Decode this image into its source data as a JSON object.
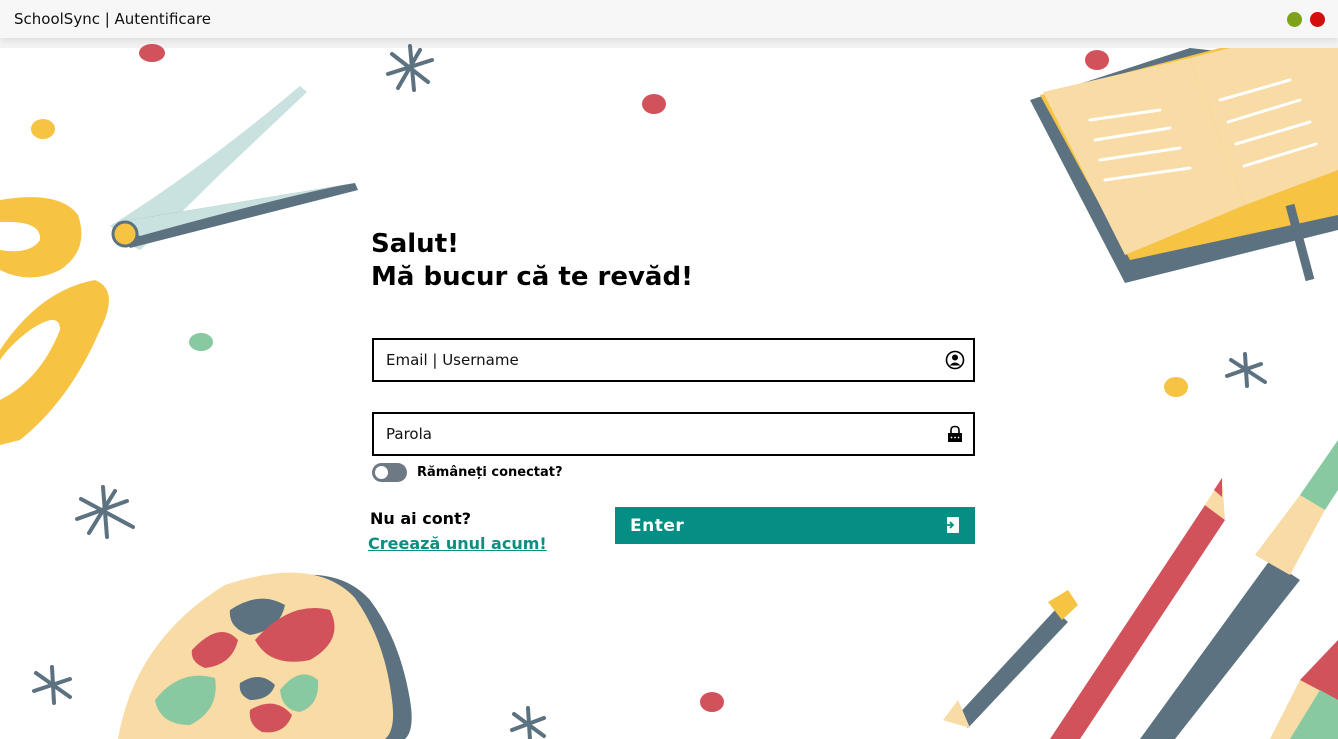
{
  "window": {
    "title": "SchoolSync | Autentificare",
    "controls": [
      "minimize-button",
      "close-button"
    ]
  },
  "greeting": {
    "line1": "Salut!",
    "line2": "Mă bucur că te revăd!"
  },
  "form": {
    "username": {
      "placeholder": "Email | Username",
      "value": "",
      "icon": "user-icon"
    },
    "password": {
      "placeholder": "Parola",
      "value": "",
      "icon": "lock-icon"
    },
    "remember": {
      "label": "Rămâneți conectat?",
      "checked": false
    }
  },
  "signup": {
    "prompt": "Nu ai cont?",
    "link": "Creează unul acum!"
  },
  "submit": {
    "label": "Enter",
    "icon": "login-icon"
  },
  "colors": {
    "accent": "#058e83",
    "link": "#0a8f82",
    "toggle_off": "#6d7a86",
    "yellow": "#f6c343",
    "red": "#d2525c",
    "slate": "#5c7280",
    "cream": "#f8dba5",
    "mint": "#88c9a1"
  }
}
